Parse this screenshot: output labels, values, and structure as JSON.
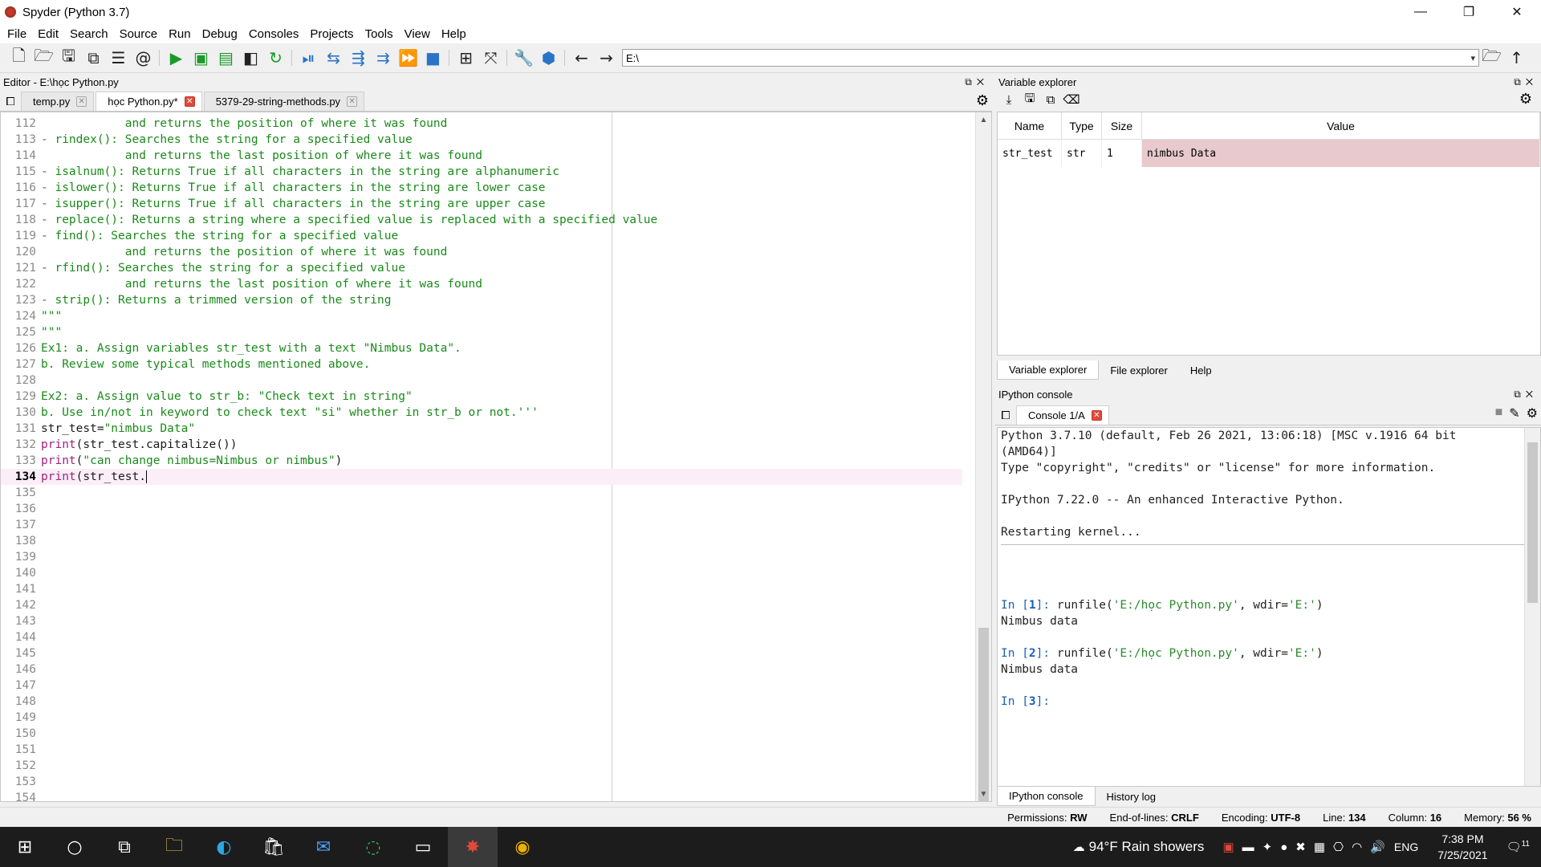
{
  "window": {
    "title": "Spyder (Python 3.7)",
    "minimize": "—",
    "maximize": "❐",
    "close": "✕"
  },
  "menu": [
    "File",
    "Edit",
    "Search",
    "Source",
    "Run",
    "Debug",
    "Consoles",
    "Projects",
    "Tools",
    "View",
    "Help"
  ],
  "toolbar": {
    "path": "E:\\"
  },
  "editor": {
    "pane_title": "Editor - E:\\học Python.py",
    "tabs": [
      {
        "label": "temp.py"
      },
      {
        "label": "học Python.py*"
      },
      {
        "label": "5379-29-string-methods.py"
      }
    ],
    "lines": [
      {
        "n": "112",
        "t": "            and returns the position of where it was found"
      },
      {
        "n": "113",
        "t": "- rindex(): Searches the string for a specified value"
      },
      {
        "n": "114",
        "t": "            and returns the last position of where it was found"
      },
      {
        "n": "115",
        "t": "- isalnum(): Returns True if all characters in the string are alphanumeric"
      },
      {
        "n": "116",
        "t": "- islower(): Returns True if all characters in the string are lower case"
      },
      {
        "n": "117",
        "t": "- isupper(): Returns True if all characters in the string are upper case"
      },
      {
        "n": "118",
        "t": "- replace(): Returns a string where a specified value is replaced with a specified value"
      },
      {
        "n": "119",
        "t": "- find(): Searches the string for a specified value"
      },
      {
        "n": "120",
        "t": "            and returns the position of where it was found"
      },
      {
        "n": "121",
        "t": "- rfind(): Searches the string for a specified value"
      },
      {
        "n": "122",
        "t": "            and returns the last position of where it was found"
      },
      {
        "n": "123",
        "t": "- strip(): Returns a trimmed version of the string"
      },
      {
        "n": "124",
        "t": "\"\"\""
      },
      {
        "n": "125",
        "t": "\"\"\""
      },
      {
        "n": "126",
        "t": "Ex1: a. Assign variables str_test with a text \"Nimbus Data\"."
      },
      {
        "n": "127",
        "t": "b. Review some typical methods mentioned above."
      },
      {
        "n": "128",
        "t": ""
      },
      {
        "n": "129",
        "t": "Ex2: a. Assign value to str_b: \"Check text in string\""
      },
      {
        "n": "130",
        "t": "b. Use in/not in keyword to check text \"si\" whether in str_b or not.'''"
      }
    ],
    "code131": {
      "n": "131",
      "a": "str_test=",
      "b": "\"nimbus Data\""
    },
    "code132": {
      "n": "132",
      "a": "print",
      "b": "(str_test.capitalize())"
    },
    "code133": {
      "n": "133",
      "a": "print",
      "b": "(",
      "c": "\"can change nimbus=Nimbus or nimbus\"",
      "d": ")"
    },
    "code134": {
      "n": "134",
      "a": "print",
      "b": "(str_test."
    },
    "empty_lines": [
      "135",
      "136",
      "137",
      "138",
      "139",
      "140",
      "141",
      "142",
      "143",
      "144",
      "145",
      "146",
      "147",
      "148",
      "149",
      "150",
      "151",
      "152",
      "153",
      "154"
    ]
  },
  "variable_explorer": {
    "title": "Variable explorer",
    "columns": {
      "name": "Name",
      "type": "Type",
      "size": "Size",
      "value": "Value"
    },
    "rows": [
      {
        "name": "str_test",
        "type": "str",
        "size": "1",
        "value": "nimbus Data"
      }
    ],
    "bottom_tabs": [
      "Variable explorer",
      "File explorer",
      "Help"
    ]
  },
  "console": {
    "title": "IPython console",
    "tab": "Console 1/A",
    "banner1": "Python 3.7.10 (default, Feb 26 2021, 13:06:18) [MSC v.1916 64 bit",
    "banner2": "(AMD64)]",
    "banner3": "Type \"copyright\", \"credits\" or \"license\" for more information.",
    "banner4": "IPython 7.22.0 -- An enhanced Interactive Python.",
    "restart": "Restarting kernel...",
    "in1": {
      "p": "In [",
      "n": "1",
      "q": "]: ",
      "cmd": "runfile(",
      "s1": "'E:/học Python.py'",
      "mid": ", wdir=",
      "s2": "'E:'",
      "end": ")"
    },
    "out1": "Nimbus data",
    "in2": {
      "p": "In [",
      "n": "2",
      "q": "]: ",
      "cmd": "runfile(",
      "s1": "'E:/học Python.py'",
      "mid": ", wdir=",
      "s2": "'E:'",
      "end": ")"
    },
    "out2": "Nimbus data",
    "in3": {
      "p": "In [",
      "n": "3",
      "q": "]:"
    },
    "bottom_tabs": [
      "IPython console",
      "History log"
    ]
  },
  "status": {
    "permissions_label": "Permissions:",
    "permissions": "RW",
    "eol_label": "End-of-lines:",
    "eol": "CRLF",
    "encoding_label": "Encoding:",
    "encoding": "UTF-8",
    "line_label": "Line:",
    "line": "134",
    "column_label": "Column:",
    "column": "16",
    "memory_label": "Memory:",
    "memory": "56 %"
  },
  "taskbar": {
    "weather": "94°F  Rain showers",
    "lang": "ENG",
    "time": "7:38 PM",
    "date": "7/25/2021",
    "notif_count": "11"
  }
}
